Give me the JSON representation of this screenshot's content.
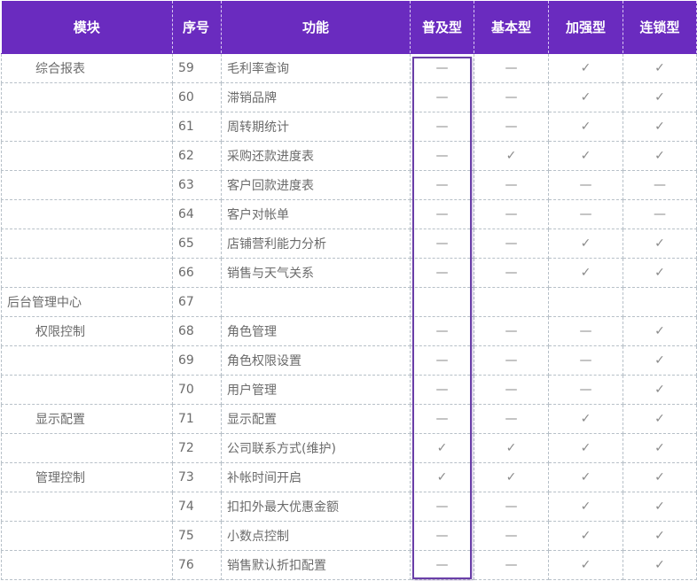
{
  "headers": {
    "module": "模块",
    "seq": "序号",
    "func": "功能",
    "v1": "普及型",
    "v2": "基本型",
    "v3": "加强型",
    "v4": "连锁型"
  },
  "rows": [
    {
      "module": "综合报表",
      "top": false,
      "seq": "59",
      "func": "毛利率查询",
      "v1": "—",
      "v2": "—",
      "v3": "✓",
      "v4": "✓"
    },
    {
      "module": "",
      "top": false,
      "seq": "60",
      "func": "滞销品牌",
      "v1": "—",
      "v2": "—",
      "v3": "✓",
      "v4": "✓"
    },
    {
      "module": "",
      "top": false,
      "seq": "61",
      "func": "周转期统计",
      "v1": "—",
      "v2": "—",
      "v3": "✓",
      "v4": "✓"
    },
    {
      "module": "",
      "top": false,
      "seq": "62",
      "func": "采购还款进度表",
      "v1": "—",
      "v2": "✓",
      "v3": "✓",
      "v4": "✓"
    },
    {
      "module": "",
      "top": false,
      "seq": "63",
      "func": "客户回款进度表",
      "v1": "—",
      "v2": "—",
      "v3": "—",
      "v4": "—"
    },
    {
      "module": "",
      "top": false,
      "seq": "64",
      "func": "客户对帐单",
      "v1": "—",
      "v2": "—",
      "v3": "—",
      "v4": "—"
    },
    {
      "module": "",
      "top": false,
      "seq": "65",
      "func": "店铺营利能力分析",
      "v1": "—",
      "v2": "—",
      "v3": "✓",
      "v4": "✓"
    },
    {
      "module": "",
      "top": false,
      "seq": "66",
      "func": "销售与天气关系",
      "v1": "—",
      "v2": "—",
      "v3": "✓",
      "v4": "✓"
    },
    {
      "module": "后台管理中心",
      "top": true,
      "seq": "67",
      "func": "",
      "v1": "",
      "v2": "",
      "v3": "",
      "v4": ""
    },
    {
      "module": "权限控制",
      "top": false,
      "seq": "68",
      "func": "角色管理",
      "v1": "—",
      "v2": "—",
      "v3": "—",
      "v4": "✓"
    },
    {
      "module": "",
      "top": false,
      "seq": "69",
      "func": "角色权限设置",
      "v1": "—",
      "v2": "—",
      "v3": "—",
      "v4": "✓"
    },
    {
      "module": "",
      "top": false,
      "seq": "70",
      "func": "用户管理",
      "v1": "—",
      "v2": "—",
      "v3": "—",
      "v4": "✓"
    },
    {
      "module": "显示配置",
      "top": false,
      "seq": "71",
      "func": "显示配置",
      "v1": "—",
      "v2": "—",
      "v3": "✓",
      "v4": "✓"
    },
    {
      "module": "",
      "top": false,
      "seq": "72",
      "func": "公司联系方式(维护)",
      "v1": "✓",
      "v2": "✓",
      "v3": "✓",
      "v4": "✓"
    },
    {
      "module": "管理控制",
      "top": false,
      "seq": "73",
      "func": "补帐时间开启",
      "v1": "✓",
      "v2": "✓",
      "v3": "✓",
      "v4": "✓"
    },
    {
      "module": "",
      "top": false,
      "seq": "74",
      "func": "扣扣外最大优惠金额",
      "v1": "—",
      "v2": "—",
      "v3": "✓",
      "v4": "✓"
    },
    {
      "module": "",
      "top": false,
      "seq": "75",
      "func": "小数点控制",
      "v1": "—",
      "v2": "—",
      "v3": "✓",
      "v4": "✓"
    },
    {
      "module": "",
      "top": false,
      "seq": "76",
      "func": "销售默认折扣配置",
      "v1": "—",
      "v2": "—",
      "v3": "✓",
      "v4": "✓"
    }
  ],
  "colors": {
    "header_bg": "#6a2bbf",
    "highlight_border": "#6a3fa8",
    "grid": "#b7c0c8"
  }
}
